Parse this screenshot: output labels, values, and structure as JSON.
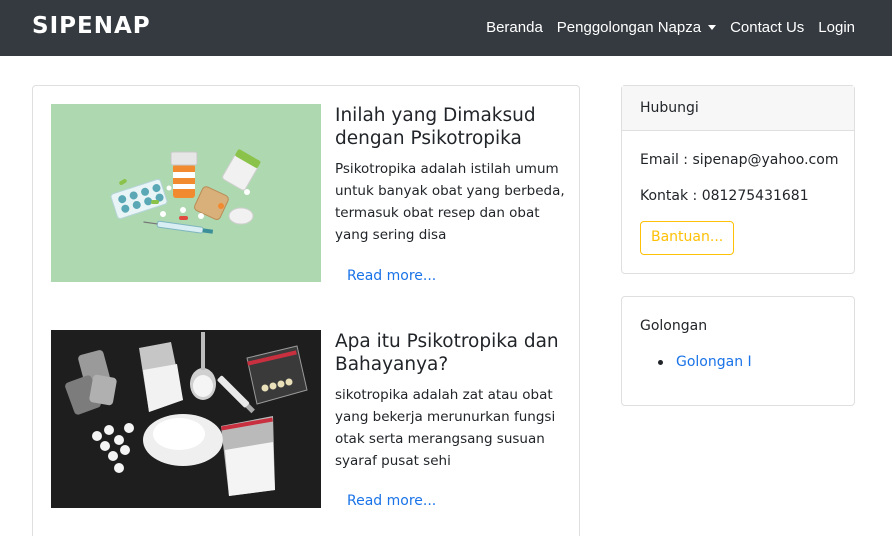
{
  "navbar": {
    "brand": "SIPENAP",
    "items": [
      {
        "label": "Beranda"
      },
      {
        "label": "Penggolongan Napza"
      },
      {
        "label": "Contact Us"
      },
      {
        "label": "Login"
      }
    ]
  },
  "posts": [
    {
      "title": "Inilah yang Dimaksud dengan Psikotropika",
      "excerpt": "Psikotropika adalah istilah umum untuk banyak obat yang berbeda, termasuk obat resep dan obat yang sering disa",
      "read_more": "Read more..."
    },
    {
      "title": "Apa itu Psikotropika dan Bahayanya?",
      "excerpt": "sikotropika adalah zat atau obat yang bekerja merunurkan fungsi otak serta merangsang susuan syaraf pusat sehi",
      "read_more": "Read more..."
    }
  ],
  "contact": {
    "header": "Hubungi",
    "email": "Email : sipenap@yahoo.com",
    "phone": "Kontak : 081275431681",
    "button": "Bantuan..."
  },
  "golongan": {
    "title": "Golongan",
    "items": [
      "Golongan I"
    ]
  },
  "colors": {
    "navbar": "#343a40",
    "link": "#1a73e8",
    "warning": "#ffc107",
    "thumb1_bg": "#aed8b0",
    "thumb2_bg": "#1c1c1c"
  }
}
